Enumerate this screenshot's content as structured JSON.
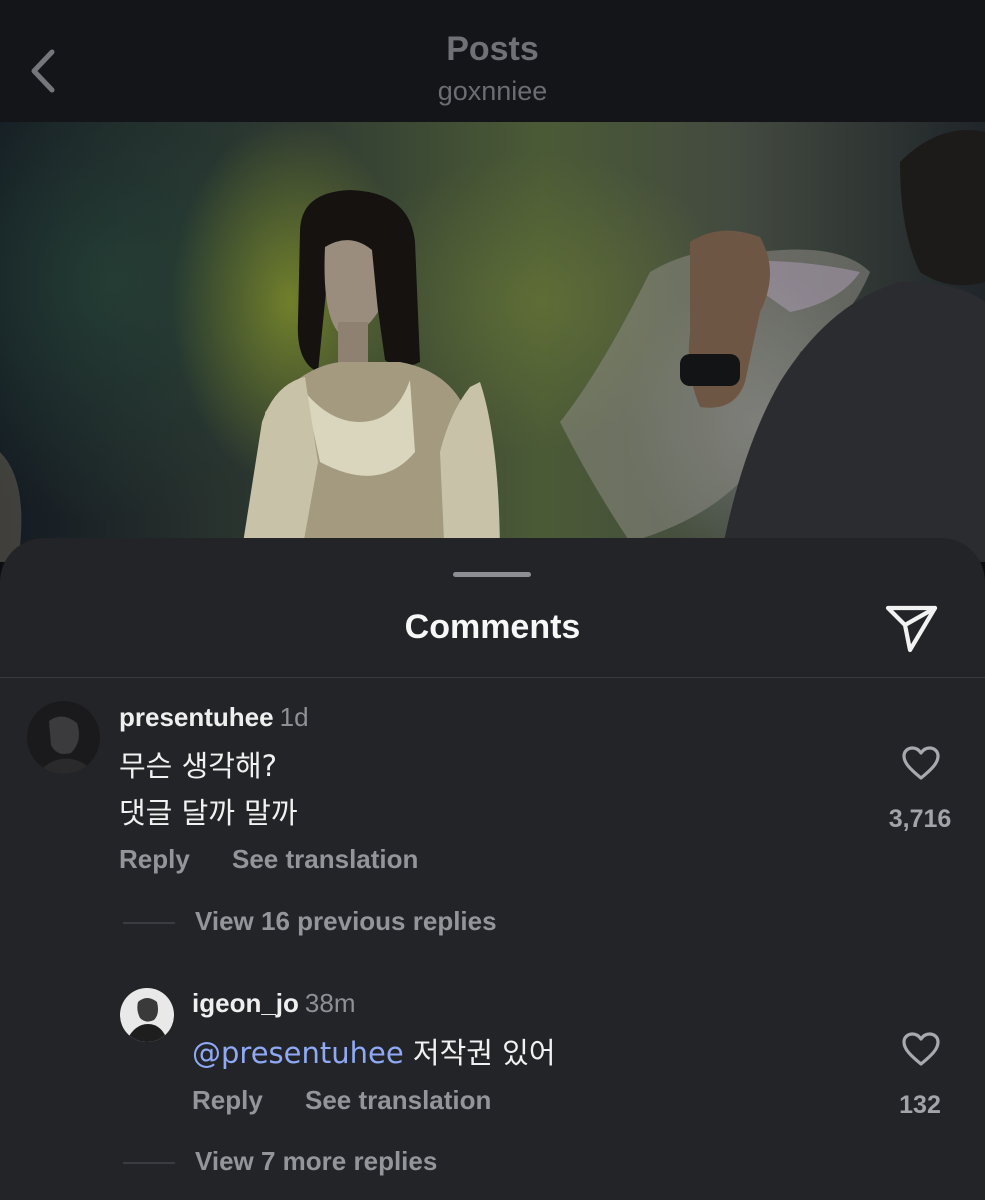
{
  "header": {
    "title": "Posts",
    "username": "goxnniee"
  },
  "comments_sheet": {
    "title": "Comments"
  },
  "comments": [
    {
      "username": "presentuhee",
      "time": "1d",
      "lines": [
        "무슨 생각해?",
        "댓글 달까 말까"
      ],
      "reply_label": "Reply",
      "translate_label": "See translation",
      "likes": "3,716"
    }
  ],
  "view_previous": "View 16 previous replies",
  "replies": [
    {
      "username": "igeon_jo",
      "time": "38m",
      "mention": "@presentuhee",
      "text": " 저작권 있어",
      "reply_label": "Reply",
      "translate_label": "See translation",
      "likes": "132"
    }
  ],
  "view_more": "View 7 more replies",
  "colors": {
    "background": "#0c0d10",
    "sheet": "#232428",
    "mention": "#8fa9f5",
    "muted_text": "#93959b"
  },
  "icons": [
    "back-chevron-icon",
    "share-paper-plane-icon",
    "heart-outline-icon"
  ]
}
